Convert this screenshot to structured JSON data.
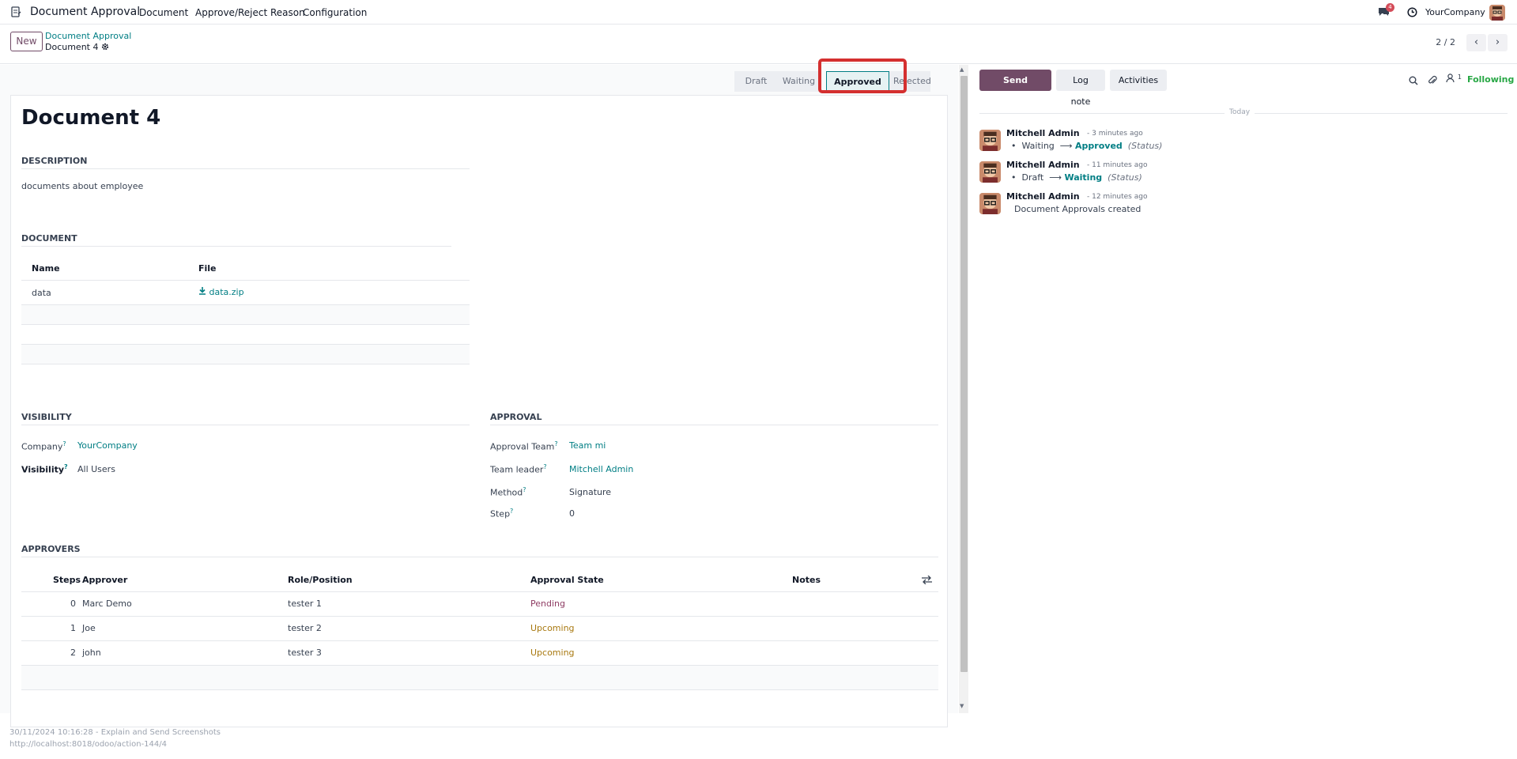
{
  "navbar": {
    "app_title": "Document Approval",
    "menus": [
      "Document",
      "Approve/Reject Reason",
      "Configuration"
    ],
    "messages_badge": "4",
    "company": "YourCompany"
  },
  "control_panel": {
    "new_label": "New",
    "breadcrumb_parent": "Document Approval",
    "breadcrumb_current": "Document 4",
    "pager": "2 / 2"
  },
  "statusbar": {
    "stages": [
      "Draft",
      "Waiting",
      "Approved",
      "Rejected"
    ],
    "active": "Approved"
  },
  "form": {
    "title": "Document 4",
    "description_header": "DESCRIPTION",
    "description": "documents about employee",
    "document_header": "DOCUMENT",
    "document_columns": [
      "Name",
      "File"
    ],
    "document_rows": [
      {
        "name": "data",
        "file": "data.zip"
      }
    ],
    "visibility_header": "VISIBILITY",
    "company_label": "Company",
    "company_value": "YourCompany",
    "visibility_label": "Visibility",
    "visibility_value": "All Users",
    "approval_header": "APPROVAL",
    "approval_team_label": "Approval Team",
    "approval_team_value": "Team mi",
    "team_leader_label": "Team leader",
    "team_leader_value": "Mitchell Admin",
    "method_label": "Method",
    "method_value": "Signature",
    "step_label": "Step",
    "step_value": "0",
    "approvers_header": "APPROVERS",
    "approver_columns": [
      "Steps",
      "Approver",
      "Role/Position",
      "Approval State",
      "Notes"
    ],
    "approver_rows": [
      {
        "step": "0",
        "approver": "Marc Demo",
        "role": "tester 1",
        "state": "Pending"
      },
      {
        "step": "1",
        "approver": "Joe",
        "role": "tester 2",
        "state": "Upcoming"
      },
      {
        "step": "2",
        "approver": "john",
        "role": "tester 3",
        "state": "Upcoming"
      }
    ]
  },
  "chatter": {
    "send_message": "Send message",
    "log_note": "Log note",
    "activities": "Activities",
    "followers_count": "1",
    "following": "Following",
    "date_separator": "Today",
    "messages": [
      {
        "author": "Mitchell Admin",
        "time": "- 3 minutes ago",
        "from": "Waiting",
        "to": "Approved",
        "field": "(Status)"
      },
      {
        "author": "Mitchell Admin",
        "time": "- 11 minutes ago",
        "from": "Draft",
        "to": "Waiting",
        "field": "(Status)"
      },
      {
        "author": "Mitchell Admin",
        "time": "- 12 minutes ago",
        "body": "Document Approvals created"
      }
    ]
  },
  "footer": {
    "line1": "30/11/2024 10:16:28 - Explain and Send Screenshots",
    "line2": "http://localhost:8018/odoo/action-144/4"
  },
  "colors": {
    "brand": "#714b67",
    "link": "#017e84",
    "highlight": "#d42f2f"
  }
}
